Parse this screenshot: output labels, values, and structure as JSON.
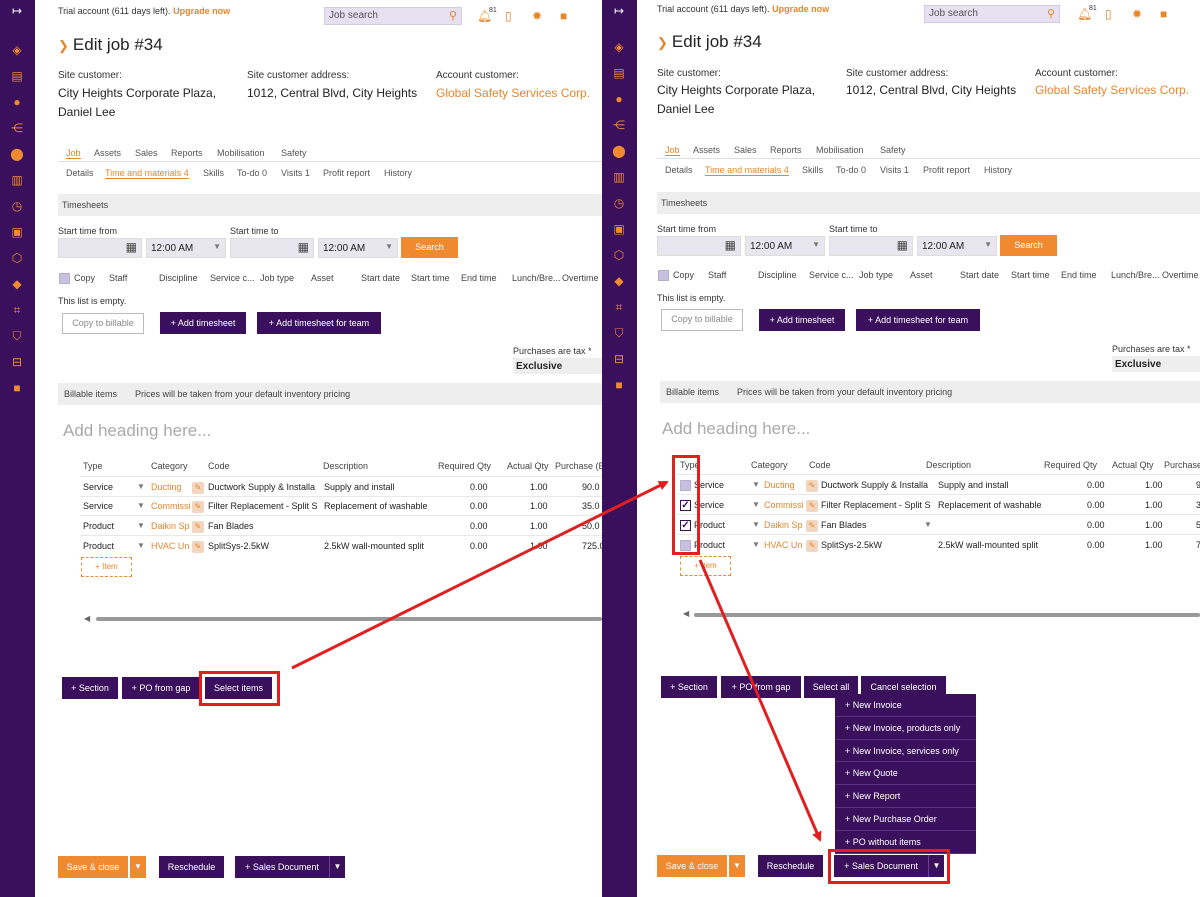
{
  "topbar": {
    "trial": "Trial account (611 days left).",
    "upgrade": "Upgrade now",
    "search_placeholder": "Job search",
    "notif_count": "81"
  },
  "page": {
    "title": "Edit job #34"
  },
  "customer": {
    "site_customer_label": "Site customer:",
    "site_customer_name": "City Heights Corporate Plaza,",
    "site_customer_contact": "Daniel Lee",
    "address_label": "Site customer address:",
    "address": "1012, Central Blvd, City Heights",
    "account_label": "Account customer:",
    "account": "Global Safety Services Corp."
  },
  "tabs": [
    "Job",
    "Assets",
    "Sales",
    "Reports",
    "Mobilisation",
    "Safety"
  ],
  "subtabs": [
    "Details",
    "Time and materials 4",
    "Skills",
    "To-do 0",
    "Visits 1",
    "Profit report",
    "History"
  ],
  "timesheets": {
    "section": "Timesheets",
    "start_from": "Start time from",
    "start_to": "Start time to",
    "time1": "12:00 AM",
    "time2": "12:00 AM",
    "search": "Search",
    "columns": [
      "Copy",
      "Staff",
      "Discipline",
      "Service c...",
      "Job type",
      "Asset",
      "Start date",
      "Start time",
      "End time",
      "Lunch/Bre...",
      "Overtime"
    ],
    "empty": "This list is empty.",
    "copy_billable": "Copy to billable",
    "add_timesheet": "+ Add timesheet",
    "add_team": "+ Add timesheet for team"
  },
  "tax": {
    "label": "Purchases are tax *",
    "value": "Exclusive"
  },
  "billable": {
    "section": "Billable items",
    "note": "Prices will be taken from your default inventory pricing",
    "heading_placeholder": "Add heading here...",
    "columns": [
      "Type",
      "Category",
      "Code",
      "Description",
      "Required Qty",
      "Actual Qty",
      "Purchase (E"
    ],
    "columns_right_last": "Purchase",
    "rows": [
      {
        "type": "Service",
        "type_r": "Service",
        "category": "Ducting",
        "category_r": "Ducting",
        "code": "Ductwork Supply & Installa",
        "description": "Supply and install",
        "required": "0.00",
        "actual": "1.00",
        "purchase": "90.0",
        "purchase_r": "9",
        "checked": false
      },
      {
        "type": "Service",
        "type_r": "Service",
        "category": "Commissi",
        "category_r": "Commissi",
        "code": "Filter Replacement - Split S",
        "description": "Replacement of washable",
        "required": "0.00",
        "actual": "1.00",
        "purchase": "35.0",
        "purchase_r": "3",
        "checked": true
      },
      {
        "type": "Product",
        "type_r": "Product",
        "category": "Daikin Sp",
        "category_r": "Daikin Sp",
        "code": "Fan Blades",
        "description": "",
        "required": "0.00",
        "actual": "1.00",
        "purchase": "50.0",
        "purchase_r": "5",
        "checked": true
      },
      {
        "type": "Product",
        "type_r": "Product",
        "category": "HVAC Un",
        "category_r": "HVAC Un",
        "code": "SplitSys-2.5kW",
        "description": "2.5kW wall-mounted split",
        "required": "0.00",
        "actual": "1.00",
        "purchase": "725.0",
        "purchase_r": "72",
        "checked": false
      }
    ],
    "add_item": "+ Item"
  },
  "actions": {
    "section": "+ Section",
    "po_gap": "+ PO from gap",
    "select_items": "Select items",
    "select_all": "Select all",
    "cancel_selection": "Cancel selection"
  },
  "footer": {
    "save_close": "Save & close",
    "reschedule": "Reschedule",
    "sales_document": "+ Sales Document"
  },
  "sales_menu": [
    "+ New Invoice",
    "+ New Invoice, products only",
    "+ New Invoice, services only",
    "+ New Quote",
    "+ New Report",
    "+ New Purchase Order",
    "+ PO without items"
  ],
  "colors": {
    "brand_purple": "#3a0f5c",
    "accent_orange": "#f08a30",
    "annotation_red": "#e02020"
  }
}
